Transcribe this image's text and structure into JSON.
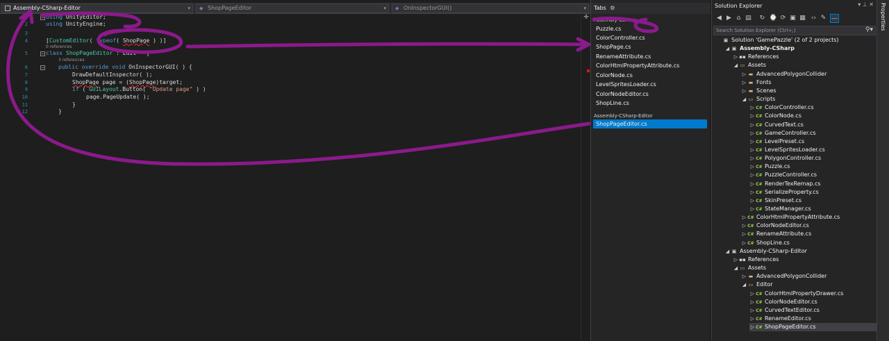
{
  "editor": {
    "nav_project": "Assembly-CSharp-Editor",
    "nav_class": "ShopPageEditor",
    "nav_member": "OnInspectorGUI()",
    "line_numbers": [
      "1",
      "2",
      "3",
      "4",
      "5",
      "6",
      "7",
      "8",
      "9",
      "10",
      "11",
      "12"
    ],
    "lens_0refs": "0 references",
    "lens_3refs": "3 references",
    "lines": {
      "l1_kw": "using",
      "l1_rest": " UnityEditor;",
      "l2_kw": "using",
      "l2_rest": " UnityEngine;",
      "l4_a": "[",
      "l4_attr": "CustomEditor",
      "l4_b": "( ",
      "l4_typeof": "typeof",
      "l4_c": "( ",
      "l4_type": "ShopPage",
      "l4_d": " ) )]",
      "l5_kw": "class",
      "l5_name": " ShopPageEditor",
      "l5_rest": " : Edit   {",
      "l6_kw1": "public",
      "l6_kw2": " override",
      "l6_kw3": " void",
      "l6_rest": " OnInspectorGUI( ) {",
      "l7": "DrawDefaultInspector( );",
      "l8_type": "ShopPage",
      "l8_rest": " page = (",
      "l8_type2": "ShopPage",
      "l8_rest2": ")target;",
      "l9_kw": "if",
      "l9_a": " ( ",
      "l9_type": "GUILayout",
      "l9_b": ".Button( ",
      "l9_str": "\"Update page\"",
      "l9_c": " ) )",
      "l10": "page.PageUpdate( );",
      "l11": "}",
      "l12": "}"
    }
  },
  "tabs": {
    "header": "Tabs",
    "group1": "Assembly-CSharp",
    "group1_items": [
      "Puzzle.cs",
      "ColorController.cs",
      "ShopPage.cs",
      "RenameAttribute.cs",
      "ColorHtmlPropertyAttribute.cs",
      "ColorNode.cs",
      "LevelSpritesLoader.cs",
      "ColorNodeEditor.cs",
      "ShopLine.cs"
    ],
    "group2": "Assembly-CSharp-Editor",
    "group2_items": [
      "ShopPageEditor.cs"
    ]
  },
  "solution_explorer": {
    "title": "Solution Explorer",
    "search_placeholder": "Search Solution Explorer (Ctrl+;)",
    "tree": [
      {
        "label": "Solution 'GamePazzle' (2 of 2 projects)",
        "depth": 0,
        "icon": "solution"
      },
      {
        "label": "Assembly-CSharp",
        "depth": 1,
        "icon": "project",
        "bold": true
      },
      {
        "label": "References",
        "depth": 2,
        "icon": "references"
      },
      {
        "label": "Assets",
        "depth": 2,
        "icon": "folder-open"
      },
      {
        "label": "AdvancedPolygonCollider",
        "depth": 3,
        "icon": "folder"
      },
      {
        "label": "Fonts",
        "depth": 3,
        "icon": "folder"
      },
      {
        "label": "Scenes",
        "depth": 3,
        "icon": "folder"
      },
      {
        "label": "Scripts",
        "depth": 3,
        "icon": "folder-open"
      },
      {
        "label": "ColorController.cs",
        "depth": 4,
        "icon": "cs"
      },
      {
        "label": "ColorNode.cs",
        "depth": 4,
        "icon": "cs"
      },
      {
        "label": "CurvedText.cs",
        "depth": 4,
        "icon": "cs"
      },
      {
        "label": "GameController.cs",
        "depth": 4,
        "icon": "cs"
      },
      {
        "label": "LevelPreset.cs",
        "depth": 4,
        "icon": "cs"
      },
      {
        "label": "LevelSpritesLoader.cs",
        "depth": 4,
        "icon": "cs"
      },
      {
        "label": "PolygonController.cs",
        "depth": 4,
        "icon": "cs"
      },
      {
        "label": "Puzzle.cs",
        "depth": 4,
        "icon": "cs"
      },
      {
        "label": "PuzzleController.cs",
        "depth": 4,
        "icon": "cs"
      },
      {
        "label": "RenderTexRemap.cs",
        "depth": 4,
        "icon": "cs"
      },
      {
        "label": "SerializeProperty.cs",
        "depth": 4,
        "icon": "cs"
      },
      {
        "label": "SkinPreset.cs",
        "depth": 4,
        "icon": "cs"
      },
      {
        "label": "StateManager.cs",
        "depth": 4,
        "icon": "cs"
      },
      {
        "label": "ColorHtmlPropertyAttribute.cs",
        "depth": 3,
        "icon": "cs"
      },
      {
        "label": "ColorNodeEditor.cs",
        "depth": 3,
        "icon": "cs"
      },
      {
        "label": "RenameAttribute.cs",
        "depth": 3,
        "icon": "cs"
      },
      {
        "label": "ShopLine.cs",
        "depth": 3,
        "icon": "cs"
      },
      {
        "label": "Assembly-CSharp-Editor",
        "depth": 1,
        "icon": "project"
      },
      {
        "label": "References",
        "depth": 2,
        "icon": "references"
      },
      {
        "label": "Assets",
        "depth": 2,
        "icon": "folder-open"
      },
      {
        "label": "AdvancedPolygonCollider",
        "depth": 3,
        "icon": "folder"
      },
      {
        "label": "Editor",
        "depth": 3,
        "icon": "folder-open"
      },
      {
        "label": "ColorHtmlPropertyDrawer.cs",
        "depth": 4,
        "icon": "cs"
      },
      {
        "label": "ColorNodeEditor.cs",
        "depth": 4,
        "icon": "cs"
      },
      {
        "label": "CurvedTextEditor.cs",
        "depth": 4,
        "icon": "cs"
      },
      {
        "label": "RenameEditor.cs",
        "depth": 4,
        "icon": "cs"
      },
      {
        "label": "ShopPageEditor.cs",
        "depth": 4,
        "icon": "cs",
        "selected": true
      }
    ]
  },
  "properties": {
    "label": "Properties"
  },
  "colors": {
    "accent": "#007acc",
    "annotation": "#8b1a8b",
    "keyword": "#569cd6",
    "type": "#4ec9b0",
    "string": "#d69d85"
  }
}
